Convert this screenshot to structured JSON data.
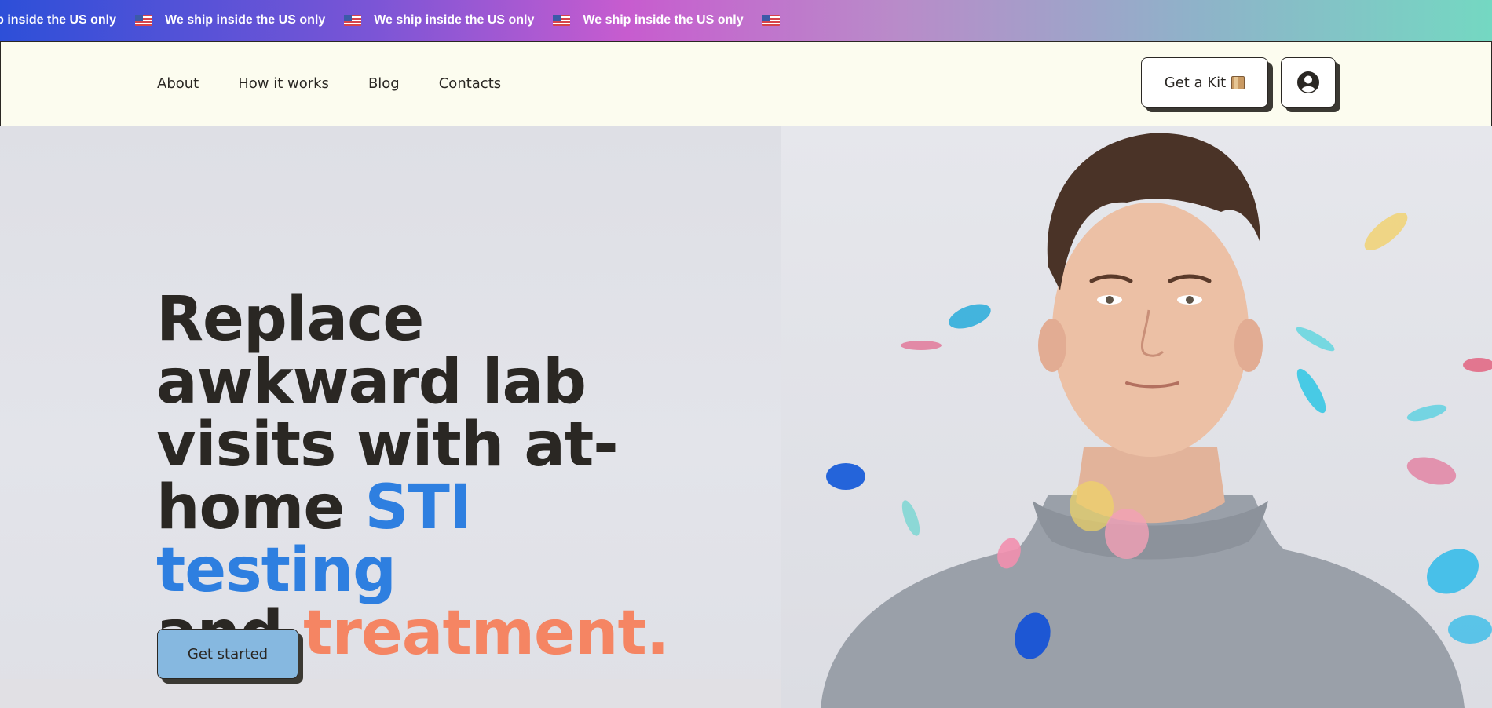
{
  "banner": {
    "text": "We ship inside the US only",
    "lead_text": "ship inside the US only",
    "icon": "us-flag-icon",
    "colors": [
      "#2d4fd8",
      "#c75ccf",
      "#74d8c2"
    ]
  },
  "header": {
    "nav": [
      "About",
      "How it works",
      "Blog",
      "Contacts"
    ],
    "kit_button": {
      "label": "Get a Kit",
      "icon": "box-icon"
    },
    "account_button": {
      "icon": "user-circle-icon"
    }
  },
  "hero": {
    "headline": {
      "line1": "Replace",
      "line2": "awkward lab",
      "line3": "visits with at-",
      "line4_prefix": "home ",
      "line4_highlight": "STI testing",
      "line5_prefix": "and ",
      "line5_highlight": "treatment."
    },
    "cta_label": "Get started",
    "colors": {
      "highlight_blue": "#2e7fe0",
      "highlight_orange": "#f58563",
      "cta": "#86b8e0"
    },
    "image": "hero-photo"
  }
}
